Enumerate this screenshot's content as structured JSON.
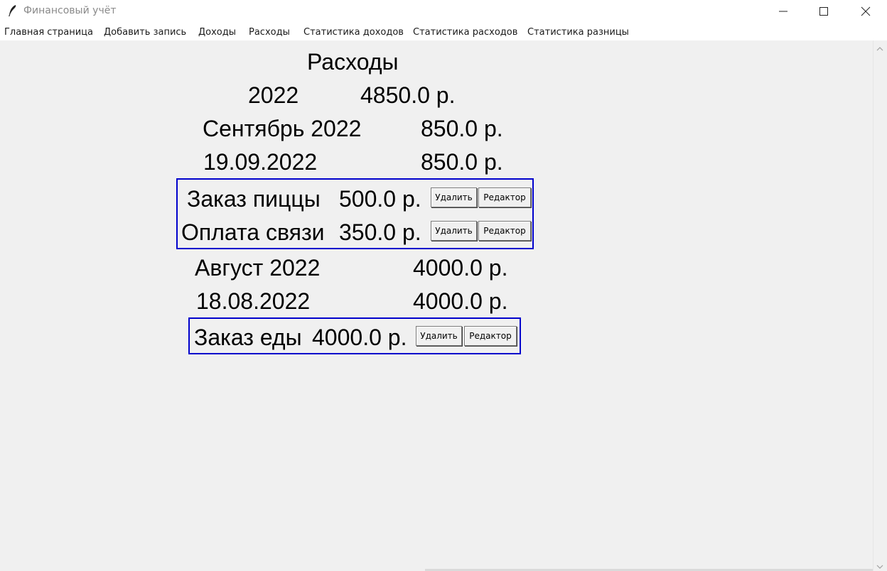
{
  "window": {
    "title": "Финансовый учёт",
    "minimize_icon": "minimize-icon",
    "maximize_icon": "maximize-icon",
    "close_icon": "close-icon"
  },
  "menu": [
    "Главная страница",
    "Добавить запись",
    "Доходы",
    "Расходы",
    "Статистика доходов",
    "Статистика расходов",
    "Статистика разницы"
  ],
  "page": {
    "title": "Расходы",
    "year": {
      "label": "2022",
      "total": "4850.0 р."
    },
    "months": [
      {
        "label": "Сентябрь 2022",
        "total": "850.0 р.",
        "day": {
          "date": "19.09.2022",
          "total": "850.0 р."
        },
        "entries": [
          {
            "name": "Заказ пиццы ",
            "amount": "500.0 р.",
            "delete_label": "Удалить",
            "edit_label": "Редактор"
          },
          {
            "name": "Оплата связи",
            "amount": "350.0 р.",
            "delete_label": "Удалить",
            "edit_label": "Редактор"
          }
        ]
      },
      {
        "label": "Август 2022",
        "total": "4000.0 р.",
        "day": {
          "date": "18.08.2022",
          "total": "4000.0 р."
        },
        "entries": [
          {
            "name": "Заказ еды",
            "amount": "4000.0 р.",
            "delete_label": "Удалить",
            "edit_label": "Редактор"
          }
        ]
      }
    ]
  },
  "colors": {
    "frame_border": "#0000cc",
    "background": "#f0f0f0"
  }
}
